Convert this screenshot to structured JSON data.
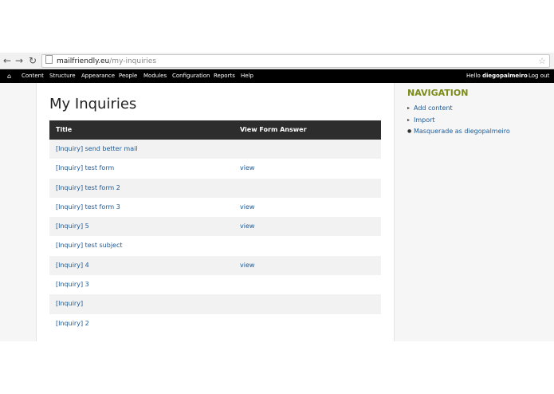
{
  "browser": {
    "url_domain": "mailfriendly.eu",
    "url_path": "/my-inquiries"
  },
  "admin_menu": {
    "items": [
      "Content",
      "Structure",
      "Appearance",
      "People",
      "Modules",
      "Configuration",
      "Reports",
      "Help"
    ],
    "hello_prefix": "Hello",
    "username": "diegopalmeiro",
    "logout": "Log out"
  },
  "main": {
    "title": "My Inquiries",
    "columns": [
      "Title",
      "View Form Answer"
    ],
    "rows": [
      {
        "title": "[Inquiry] send better mail",
        "view": ""
      },
      {
        "title": "[Inquiry] test form",
        "view": "view"
      },
      {
        "title": "[Inquiry] test form 2",
        "view": ""
      },
      {
        "title": "[Inquiry] test form 3",
        "view": "view"
      },
      {
        "title": "[Inquiry] 5",
        "view": "view"
      },
      {
        "title": "[Inquiry] test subject",
        "view": ""
      },
      {
        "title": "[Inquiry] 4",
        "view": "view"
      },
      {
        "title": "[Inquiry] 3",
        "view": ""
      },
      {
        "title": "[Inquiry]",
        "view": ""
      },
      {
        "title": "[Inquiry] 2",
        "view": ""
      }
    ]
  },
  "sidebar": {
    "heading": "NAVIGATION",
    "items": [
      {
        "label": "Add content",
        "bullet": "▸"
      },
      {
        "label": "Import",
        "bullet": "▸"
      },
      {
        "label": "Masquerade as diegopalmeiro",
        "bullet": "●"
      }
    ]
  }
}
